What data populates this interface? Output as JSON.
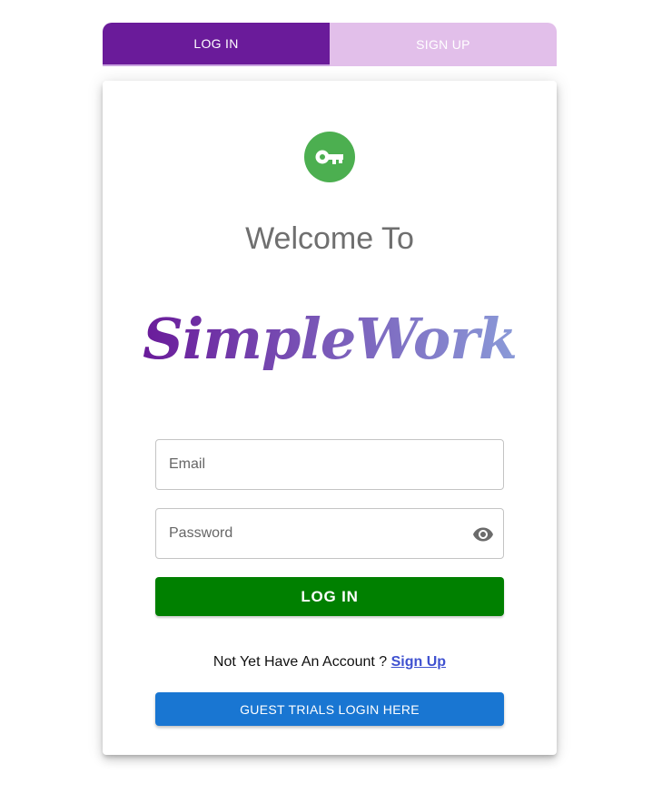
{
  "tabs": [
    {
      "label": "LOG IN",
      "active": true
    },
    {
      "label": "SIGN UP",
      "active": false
    }
  ],
  "card": {
    "icon": "key-icon",
    "welcome": "Welcome To",
    "brand": "SimpleWork"
  },
  "form": {
    "email_placeholder": "Email",
    "email_value": "",
    "password_placeholder": "Password",
    "password_value": "",
    "login_label": "LOG IN",
    "signup_prompt": "Not Yet Have An Account ?",
    "signup_link": "Sign Up",
    "guest_label": "GUEST TRIALS LOGIN HERE",
    "visibility_icon": "eye-icon"
  },
  "colors": {
    "tab_active": "#6a1b9a",
    "tab_inactive": "#e2bfea",
    "avatar": "#4caf50",
    "login_button": "#008000",
    "guest_button": "#1976d2",
    "link": "#3f51d0",
    "brand_gradient_start": "#6a1b9a",
    "brand_gradient_end": "#8a9ad8"
  }
}
